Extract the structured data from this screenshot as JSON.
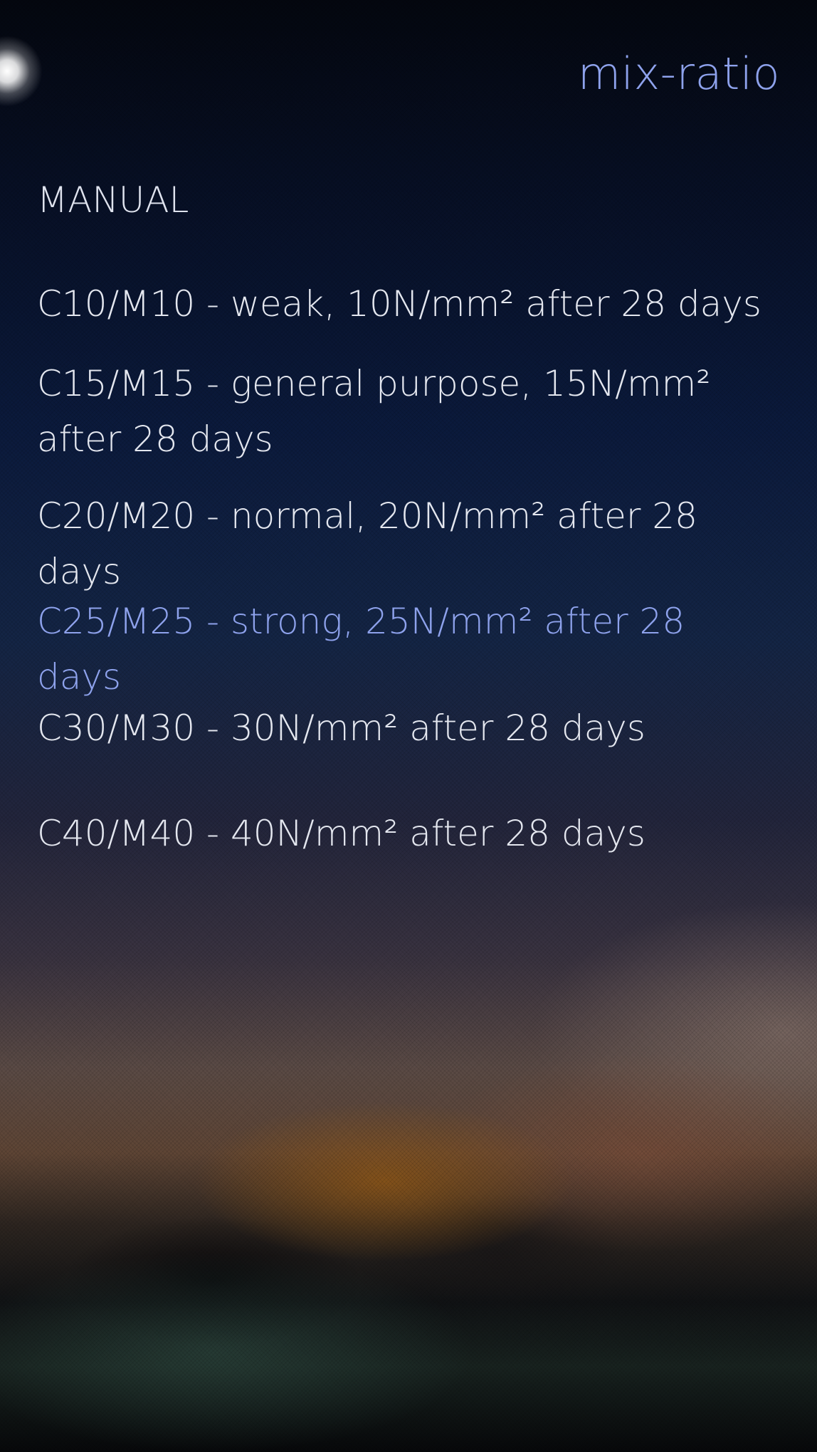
{
  "page": {
    "title": "mix-ratio"
  },
  "section": {
    "header": "MANUAL"
  },
  "items": [
    {
      "label": "C10/M10 - weak, 10N/mm² after 28 days"
    },
    {
      "label": "C15/M15 - general purpose, 15N/mm² after 28 days"
    },
    {
      "label": "C20/M20 - normal, 20N/mm² after 28 days"
    },
    {
      "label": "C25/M25 - strong, 25N/mm² after 28 days",
      "highlighted": true
    },
    {
      "label": "C30/M30 - 30N/mm² after 28 days"
    },
    {
      "label": "C40/M40 - 40N/mm² after 28 days"
    }
  ],
  "colors": {
    "accent": "#8ea2ec",
    "text": "#e4e7ef"
  }
}
